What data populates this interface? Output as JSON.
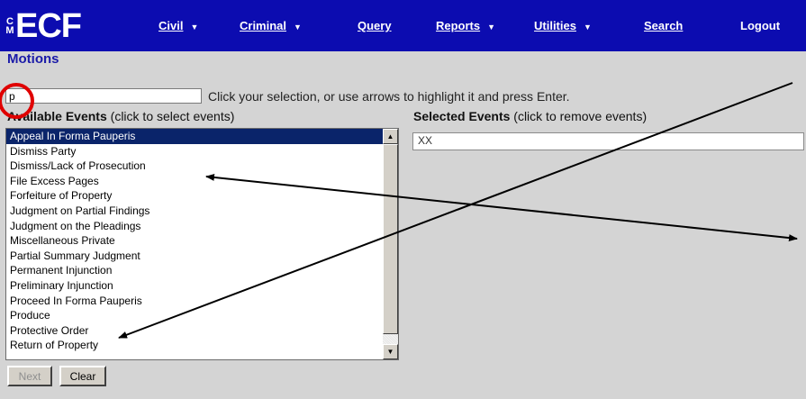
{
  "logo": {
    "cm": "CM",
    "ecf": "ECF"
  },
  "menu": [
    {
      "label": "Civil",
      "has_dropdown": true
    },
    {
      "label": "Criminal",
      "has_dropdown": true
    },
    {
      "label": "Query",
      "has_dropdown": false
    },
    {
      "label": "Reports",
      "has_dropdown": true
    },
    {
      "label": "Utilities",
      "has_dropdown": true
    },
    {
      "label": "Search",
      "has_dropdown": false
    },
    {
      "label": "Logout",
      "has_dropdown": false
    }
  ],
  "page": {
    "title": "Motions"
  },
  "filter": {
    "value": "p",
    "hint": "Click your selection, or use arrows to highlight it and press Enter."
  },
  "available": {
    "heading": "Available Events",
    "note": "(click to select events)",
    "items": [
      "Appeal In Forma Pauperis",
      "Dismiss Party",
      "Dismiss/Lack of Prosecution",
      "File Excess Pages",
      "Forfeiture of Property",
      "Judgment on Partial Findings",
      "Judgment on the Pleadings",
      "Miscellaneous Private",
      "Partial Summary Judgment",
      "Permanent Injunction",
      "Preliminary Injunction",
      "Proceed In Forma Pauperis",
      "Produce",
      "Protective Order",
      "Return of Property"
    ],
    "selected_index": 0
  },
  "selected": {
    "heading": "Selected Events",
    "note": "(click to remove events)",
    "value": "XX"
  },
  "buttons": {
    "next": "Next",
    "clear": "Clear"
  },
  "colors": {
    "menubar": "#0c0cb0",
    "title": "#1a1aa8",
    "highlight": "#0a246a",
    "annotation": "#e00000"
  }
}
